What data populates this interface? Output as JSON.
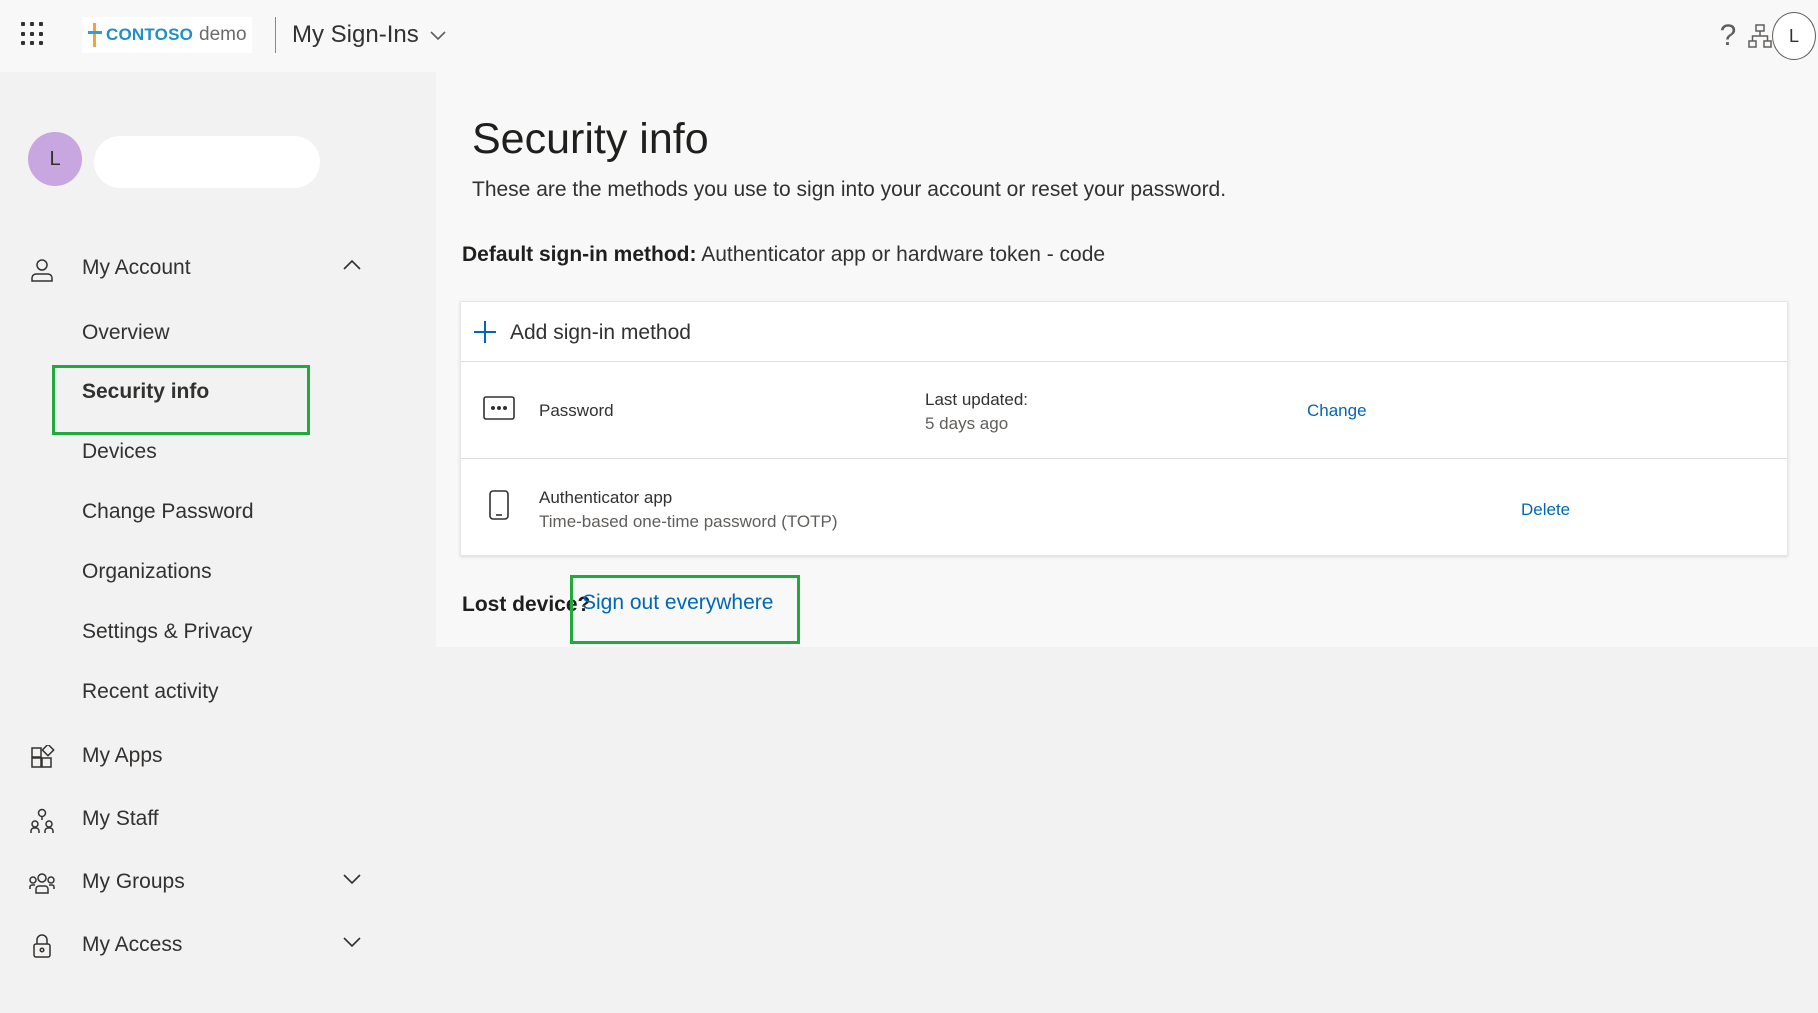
{
  "header": {
    "brand_name": "CONTOSO",
    "brand_suffix": "demo",
    "app_title": "My Sign-Ins",
    "user_initial": "L"
  },
  "sidebar": {
    "user_initial": "L",
    "items": [
      {
        "label": "My Account",
        "icon": "person-icon",
        "expanded": true
      },
      {
        "label": "My Apps",
        "icon": "apps-icon"
      },
      {
        "label": "My Staff",
        "icon": "org-people-icon"
      },
      {
        "label": "My Groups",
        "icon": "groups-icon",
        "expanded": false
      },
      {
        "label": "My Access",
        "icon": "lock-icon",
        "expanded": false
      }
    ],
    "account_subitems": [
      "Overview",
      "Security info",
      "Devices",
      "Change Password",
      "Organizations",
      "Settings & Privacy",
      "Recent activity"
    ],
    "active_subitem": "Security info"
  },
  "main": {
    "title": "Security info",
    "description": "These are the methods you use to sign into your account or reset your password.",
    "default_method_label": "Default sign-in method:",
    "default_method_value": "Authenticator app or hardware token - code",
    "add_method_label": "Add sign-in method",
    "methods": [
      {
        "name": "Password",
        "icon": "password-dots-icon",
        "updated_label": "Last updated:",
        "updated_value": "5 days ago",
        "action": "Change"
      },
      {
        "name": "Authenticator app",
        "sub": "Time-based one-time password (TOTP)",
        "icon": "phone-icon",
        "action": "Delete"
      }
    ],
    "lost_device_label": "Lost device?",
    "sign_out_link": "Sign out everywhere"
  },
  "colors": {
    "accent_link": "#0067b8",
    "highlight_box": "#21a93c",
    "avatar_purple": "#c8a6e0",
    "brand_blue": "#1f8fc7",
    "brand_orange": "#f2a33a"
  }
}
